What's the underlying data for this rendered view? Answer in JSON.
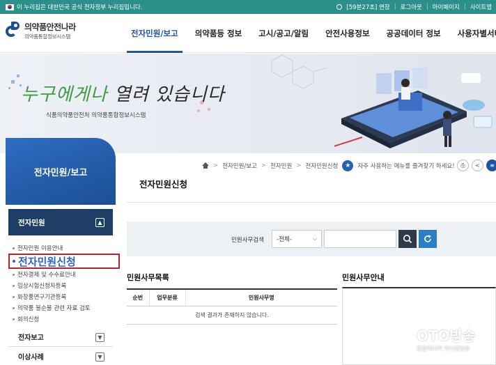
{
  "gov_bar": {
    "notice": "이 누리집은 대한민국 공식 전자정부 누리집입니다.",
    "session": "[59분27초] 연장",
    "logout": "로그아웃",
    "mypage": "마이페이지",
    "sitemap": "사이트맵"
  },
  "logo": {
    "title": "의약품안전나라",
    "subtitle": "의약품통합정보시스템"
  },
  "gnb": [
    {
      "label": "전자민원/보고"
    },
    {
      "label": "의약품등 정보"
    },
    {
      "label": "고시/공고/알림"
    },
    {
      "label": "안전사용정보"
    },
    {
      "label": "공공데이터 정보"
    },
    {
      "label": "사용자별서비스"
    }
  ],
  "banner": {
    "slogan_part1": "누구에게나 ",
    "slogan_part2": "열려 있습니다",
    "subtitle": "식품의약품안전처 의약품통합정보시스템"
  },
  "lnb": {
    "title": "전자민원/보고",
    "group": "전자민원",
    "items": [
      "전자민원 이용안내",
      "전자민원신청",
      "전자결제 및 수수료안내",
      "임상시험신청자등록",
      "화장품연구기관등록",
      "의약품 불순물 관련 자료 검토",
      "회의신청"
    ],
    "collapsed": [
      "전자보고",
      "이상사례"
    ]
  },
  "breadcrumb": {
    "items": [
      "전자민원/보고",
      "전자민원",
      "전자민원신청"
    ],
    "favorite_text": "자주 사용하는 메뉴를 즐겨찾기 하세요!"
  },
  "page_title": "전자민원신청",
  "search": {
    "label": "민원사무검색",
    "select_value": "-전체-"
  },
  "list": {
    "title": "민원사무목록",
    "headers": [
      "순번",
      "업무분류",
      "민원사무명"
    ],
    "empty": "검색 결과가 존재하지 않습니다."
  },
  "guide": {
    "title": "민원사무안내"
  },
  "watermark": {
    "brand": "OTO방송",
    "tagline": "종합미디어 언더넷방송"
  },
  "colors": {
    "gov_bar": "#2d8f8a",
    "primary": "#1d54a4",
    "lnb_head": "#1e3e66",
    "highlight_border": "#b8222a"
  }
}
